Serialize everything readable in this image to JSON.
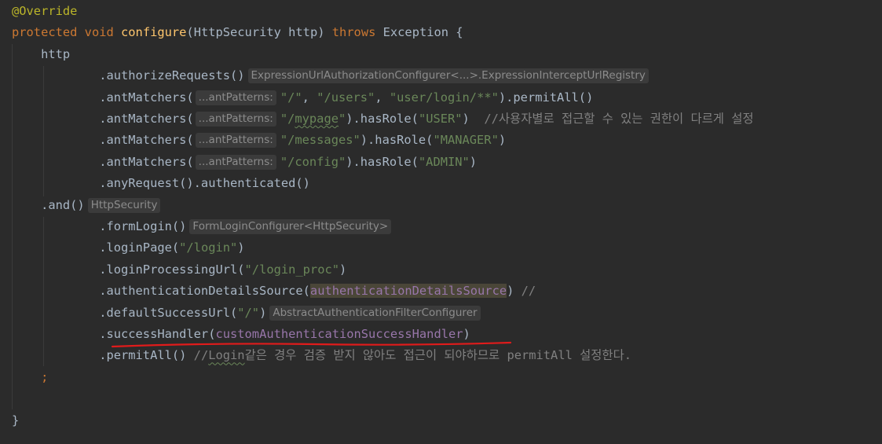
{
  "editor": {
    "lines": [
      {
        "indent": "",
        "tokens": [
          {
            "c": "ann",
            "t": "@Override"
          }
        ]
      },
      {
        "indent": "",
        "tokens": [
          {
            "c": "kw",
            "t": "protected "
          },
          {
            "c": "kw",
            "t": "void "
          },
          {
            "c": "fn",
            "t": "configure"
          },
          {
            "c": "plain",
            "t": "(HttpSecurity http) "
          },
          {
            "c": "kw",
            "t": "throws "
          },
          {
            "c": "plain",
            "t": "Exception {"
          }
        ]
      },
      {
        "indent": "    ",
        "tokens": [
          {
            "c": "plain",
            "t": "http"
          }
        ]
      },
      {
        "indent": "            ",
        "tokens": [
          {
            "c": "plain",
            "t": ".authorizeRequests()"
          },
          {
            "c": "hint",
            "t": "ExpressionUrlAuthorizationConfigurer<...>.ExpressionInterceptUrlRegistry"
          }
        ]
      },
      {
        "indent": "            ",
        "tokens": [
          {
            "c": "plain",
            "t": ".antMatchers("
          },
          {
            "c": "hint-param",
            "t": "...antPatterns:"
          },
          {
            "c": "str",
            "t": "\"/\""
          },
          {
            "c": "plain",
            "t": ", "
          },
          {
            "c": "str",
            "t": "\"/users\""
          },
          {
            "c": "plain",
            "t": ", "
          },
          {
            "c": "str",
            "t": "\"user/login/**\""
          },
          {
            "c": "plain",
            "t": ").permitAll()"
          }
        ]
      },
      {
        "indent": "            ",
        "tokens": [
          {
            "c": "plain",
            "t": ".antMatchers("
          },
          {
            "c": "hint-param",
            "t": "...antPatterns:"
          },
          {
            "c": "str",
            "t": "\"/"
          },
          {
            "c": "str-typo",
            "t": "mypage"
          },
          {
            "c": "str",
            "t": "\""
          },
          {
            "c": "plain",
            "t": ").hasRole("
          },
          {
            "c": "str",
            "t": "\"USER\""
          },
          {
            "c": "plain",
            "t": ")  "
          },
          {
            "c": "cmt",
            "t": "//사용자별로 접근할 수 있는 권한이 다르게 설정"
          }
        ]
      },
      {
        "indent": "            ",
        "tokens": [
          {
            "c": "plain",
            "t": ".antMatchers("
          },
          {
            "c": "hint-param",
            "t": "...antPatterns:"
          },
          {
            "c": "str",
            "t": "\"/messages\""
          },
          {
            "c": "plain",
            "t": ").hasRole("
          },
          {
            "c": "str",
            "t": "\"MANAGER\""
          },
          {
            "c": "plain",
            "t": ")"
          }
        ]
      },
      {
        "indent": "            ",
        "tokens": [
          {
            "c": "plain",
            "t": ".antMatchers("
          },
          {
            "c": "hint-param",
            "t": "...antPatterns:"
          },
          {
            "c": "str",
            "t": "\"/config\""
          },
          {
            "c": "plain",
            "t": ").hasRole("
          },
          {
            "c": "str",
            "t": "\"ADMIN\""
          },
          {
            "c": "plain",
            "t": ")"
          }
        ]
      },
      {
        "indent": "            ",
        "tokens": [
          {
            "c": "plain",
            "t": ".anyRequest().authenticated()"
          }
        ]
      },
      {
        "indent": "    ",
        "tokens": [
          {
            "c": "plain",
            "t": ".and()"
          },
          {
            "c": "hint",
            "t": "HttpSecurity"
          }
        ]
      },
      {
        "indent": "            ",
        "tokens": [
          {
            "c": "plain",
            "t": ".formLogin()"
          },
          {
            "c": "hint",
            "t": "FormLoginConfigurer<HttpSecurity>"
          }
        ]
      },
      {
        "indent": "            ",
        "tokens": [
          {
            "c": "plain",
            "t": ".loginPage("
          },
          {
            "c": "str",
            "t": "\"/login\""
          },
          {
            "c": "plain",
            "t": ")"
          }
        ]
      },
      {
        "indent": "            ",
        "tokens": [
          {
            "c": "plain",
            "t": ".loginProcessingUrl("
          },
          {
            "c": "str",
            "t": "\"/login_proc\""
          },
          {
            "c": "plain",
            "t": ")"
          }
        ]
      },
      {
        "indent": "            ",
        "tokens": [
          {
            "c": "plain",
            "t": ".authenticationDetailsSource("
          },
          {
            "c": "fld-hl",
            "t": "authenticationDetailsSource"
          },
          {
            "c": "plain",
            "t": ") "
          },
          {
            "c": "cmt",
            "t": "//"
          }
        ]
      },
      {
        "indent": "            ",
        "tokens": [
          {
            "c": "plain",
            "t": ".defaultSuccessUrl("
          },
          {
            "c": "str",
            "t": "\"/\""
          },
          {
            "c": "plain",
            "t": ")"
          },
          {
            "c": "hint",
            "t": "AbstractAuthenticationFilterConfigurer"
          }
        ]
      },
      {
        "indent": "            ",
        "tokens": [
          {
            "c": "plain",
            "t": ".successHandler("
          },
          {
            "c": "fld",
            "t": "customAuthenticationSuccessHandler"
          },
          {
            "c": "plain",
            "t": ")"
          }
        ]
      },
      {
        "indent": "            ",
        "tokens": [
          {
            "c": "plain",
            "t": ".permitAll() "
          },
          {
            "c": "cmt",
            "t": "//"
          },
          {
            "c": "cmt-typo",
            "t": "Login"
          },
          {
            "c": "cmt",
            "t": "같은 경우 검증 받지 않아도 접근이 되야하므로 permitAll 설정한다."
          }
        ]
      },
      {
        "indent": "    ",
        "tokens": [
          {
            "c": "kw",
            "t": ";"
          }
        ]
      },
      {
        "indent": "",
        "tokens": []
      },
      {
        "indent": "",
        "tokens": [
          {
            "c": "plain",
            "t": "}"
          }
        ]
      }
    ]
  },
  "colors": {
    "background": "#2b2b2b",
    "keyword": "#cc7832",
    "annotation": "#bbb529",
    "method_decl": "#ffc66d",
    "string": "#6a8759",
    "comment": "#808080",
    "field": "#9876aa",
    "default": "#a9b7c6",
    "red_underline": "#e01b1b"
  }
}
